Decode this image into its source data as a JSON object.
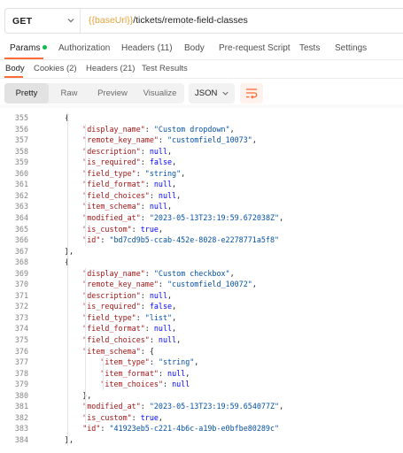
{
  "request": {
    "method": "GET",
    "url_var": "{{baseUrl}}",
    "url_path": "/tickets/remote-field-classes"
  },
  "request_tabs": [
    {
      "label": "Params",
      "active": true,
      "has_dot": true
    },
    {
      "label": "Authorization"
    },
    {
      "label": "Headers (11)"
    },
    {
      "label": "Body"
    },
    {
      "label": "Pre-request Script"
    },
    {
      "label": "Tests"
    },
    {
      "label": "Settings"
    }
  ],
  "response_tabs": [
    {
      "label": "Body",
      "active": true
    },
    {
      "label": "Cookies (2)"
    },
    {
      "label": "Headers (21)"
    },
    {
      "label": "Test Results"
    }
  ],
  "view_modes": [
    {
      "label": "Pretty",
      "active": true
    },
    {
      "label": "Raw"
    },
    {
      "label": "Preview"
    },
    {
      "label": "Visualize"
    }
  ],
  "format_select": {
    "value": "JSON"
  },
  "colors": {
    "accent": "#ff6c37",
    "key": "#a31515",
    "string": "#0451a5",
    "keyword": "#0000ff",
    "url_variable": "#e5a33a"
  },
  "code_lines": [
    {
      "n": "355",
      "indent": 1,
      "parts": [
        [
          "p",
          "{"
        ]
      ]
    },
    {
      "n": "356",
      "indent": 2,
      "parts": [
        [
          "k",
          "\"display_name\""
        ],
        [
          "p",
          ": "
        ],
        [
          "s",
          "\"Custom dropdown\""
        ],
        [
          "p",
          ","
        ]
      ]
    },
    {
      "n": "357",
      "indent": 2,
      "parts": [
        [
          "k",
          "\"remote_key_name\""
        ],
        [
          "p",
          ": "
        ],
        [
          "s",
          "\"customfield_10073\""
        ],
        [
          "p",
          ","
        ]
      ]
    },
    {
      "n": "358",
      "indent": 2,
      "parts": [
        [
          "k",
          "\"description\""
        ],
        [
          "p",
          ": "
        ],
        [
          "kw",
          "null"
        ],
        [
          "p",
          ","
        ]
      ]
    },
    {
      "n": "359",
      "indent": 2,
      "parts": [
        [
          "k",
          "\"is_required\""
        ],
        [
          "p",
          ": "
        ],
        [
          "kw",
          "false"
        ],
        [
          "p",
          ","
        ]
      ]
    },
    {
      "n": "360",
      "indent": 2,
      "parts": [
        [
          "k",
          "\"field_type\""
        ],
        [
          "p",
          ": "
        ],
        [
          "s",
          "\"string\""
        ],
        [
          "p",
          ","
        ]
      ]
    },
    {
      "n": "361",
      "indent": 2,
      "parts": [
        [
          "k",
          "\"field_format\""
        ],
        [
          "p",
          ": "
        ],
        [
          "kw",
          "null"
        ],
        [
          "p",
          ","
        ]
      ]
    },
    {
      "n": "362",
      "indent": 2,
      "parts": [
        [
          "k",
          "\"field_choices\""
        ],
        [
          "p",
          ": "
        ],
        [
          "kw",
          "null"
        ],
        [
          "p",
          ","
        ]
      ]
    },
    {
      "n": "363",
      "indent": 2,
      "parts": [
        [
          "k",
          "\"item_schema\""
        ],
        [
          "p",
          ": "
        ],
        [
          "kw",
          "null"
        ],
        [
          "p",
          ","
        ]
      ]
    },
    {
      "n": "364",
      "indent": 2,
      "parts": [
        [
          "k",
          "\"modified_at\""
        ],
        [
          "p",
          ": "
        ],
        [
          "s",
          "\"2023-05-13T23:19:59.672038Z\""
        ],
        [
          "p",
          ","
        ]
      ]
    },
    {
      "n": "365",
      "indent": 2,
      "parts": [
        [
          "k",
          "\"is_custom\""
        ],
        [
          "p",
          ": "
        ],
        [
          "kw",
          "true"
        ],
        [
          "p",
          ","
        ]
      ]
    },
    {
      "n": "366",
      "indent": 2,
      "parts": [
        [
          "k",
          "\"id\""
        ],
        [
          "p",
          ": "
        ],
        [
          "s",
          "\"bd7cd9b5-ccab-452e-8028-e2278771a5f8\""
        ]
      ]
    },
    {
      "n": "367",
      "indent": 1,
      "parts": [
        [
          "p",
          "},"
        ]
      ]
    },
    {
      "n": "368",
      "indent": 1,
      "parts": [
        [
          "p",
          "{"
        ]
      ]
    },
    {
      "n": "369",
      "indent": 2,
      "parts": [
        [
          "k",
          "\"display_name\""
        ],
        [
          "p",
          ": "
        ],
        [
          "s",
          "\"Custom checkbox\""
        ],
        [
          "p",
          ","
        ]
      ]
    },
    {
      "n": "370",
      "indent": 2,
      "parts": [
        [
          "k",
          "\"remote_key_name\""
        ],
        [
          "p",
          ": "
        ],
        [
          "s",
          "\"customfield_10072\""
        ],
        [
          "p",
          ","
        ]
      ]
    },
    {
      "n": "371",
      "indent": 2,
      "parts": [
        [
          "k",
          "\"description\""
        ],
        [
          "p",
          ": "
        ],
        [
          "kw",
          "null"
        ],
        [
          "p",
          ","
        ]
      ]
    },
    {
      "n": "372",
      "indent": 2,
      "parts": [
        [
          "k",
          "\"is_required\""
        ],
        [
          "p",
          ": "
        ],
        [
          "kw",
          "false"
        ],
        [
          "p",
          ","
        ]
      ]
    },
    {
      "n": "373",
      "indent": 2,
      "parts": [
        [
          "k",
          "\"field_type\""
        ],
        [
          "p",
          ": "
        ],
        [
          "s",
          "\"list\""
        ],
        [
          "p",
          ","
        ]
      ]
    },
    {
      "n": "374",
      "indent": 2,
      "parts": [
        [
          "k",
          "\"field_format\""
        ],
        [
          "p",
          ": "
        ],
        [
          "kw",
          "null"
        ],
        [
          "p",
          ","
        ]
      ]
    },
    {
      "n": "375",
      "indent": 2,
      "parts": [
        [
          "k",
          "\"field_choices\""
        ],
        [
          "p",
          ": "
        ],
        [
          "kw",
          "null"
        ],
        [
          "p",
          ","
        ]
      ]
    },
    {
      "n": "376",
      "indent": 2,
      "parts": [
        [
          "k",
          "\"item_schema\""
        ],
        [
          "p",
          ": {"
        ]
      ]
    },
    {
      "n": "377",
      "indent": 3,
      "parts": [
        [
          "k",
          "\"item_type\""
        ],
        [
          "p",
          ": "
        ],
        [
          "s",
          "\"string\""
        ],
        [
          "p",
          ","
        ]
      ]
    },
    {
      "n": "378",
      "indent": 3,
      "parts": [
        [
          "k",
          "\"item_format\""
        ],
        [
          "p",
          ": "
        ],
        [
          "kw",
          "null"
        ],
        [
          "p",
          ","
        ]
      ]
    },
    {
      "n": "379",
      "indent": 3,
      "parts": [
        [
          "k",
          "\"item_choices\""
        ],
        [
          "p",
          ": "
        ],
        [
          "kw",
          "null"
        ]
      ]
    },
    {
      "n": "380",
      "indent": 2,
      "parts": [
        [
          "p",
          "},"
        ]
      ]
    },
    {
      "n": "381",
      "indent": 2,
      "parts": [
        [
          "k",
          "\"modified_at\""
        ],
        [
          "p",
          ": "
        ],
        [
          "s",
          "\"2023-05-13T23:19:59.654077Z\""
        ],
        [
          "p",
          ","
        ]
      ]
    },
    {
      "n": "382",
      "indent": 2,
      "parts": [
        [
          "k",
          "\"is_custom\""
        ],
        [
          "p",
          ": "
        ],
        [
          "kw",
          "true"
        ],
        [
          "p",
          ","
        ]
      ]
    },
    {
      "n": "383",
      "indent": 2,
      "parts": [
        [
          "k",
          "\"id\""
        ],
        [
          "p",
          ": "
        ],
        [
          "s",
          "\"41923eb5-c221-4b6c-a19b-e0bfbe80289c\""
        ]
      ]
    },
    {
      "n": "384",
      "indent": 1,
      "parts": [
        [
          "p",
          "},"
        ]
      ]
    }
  ]
}
